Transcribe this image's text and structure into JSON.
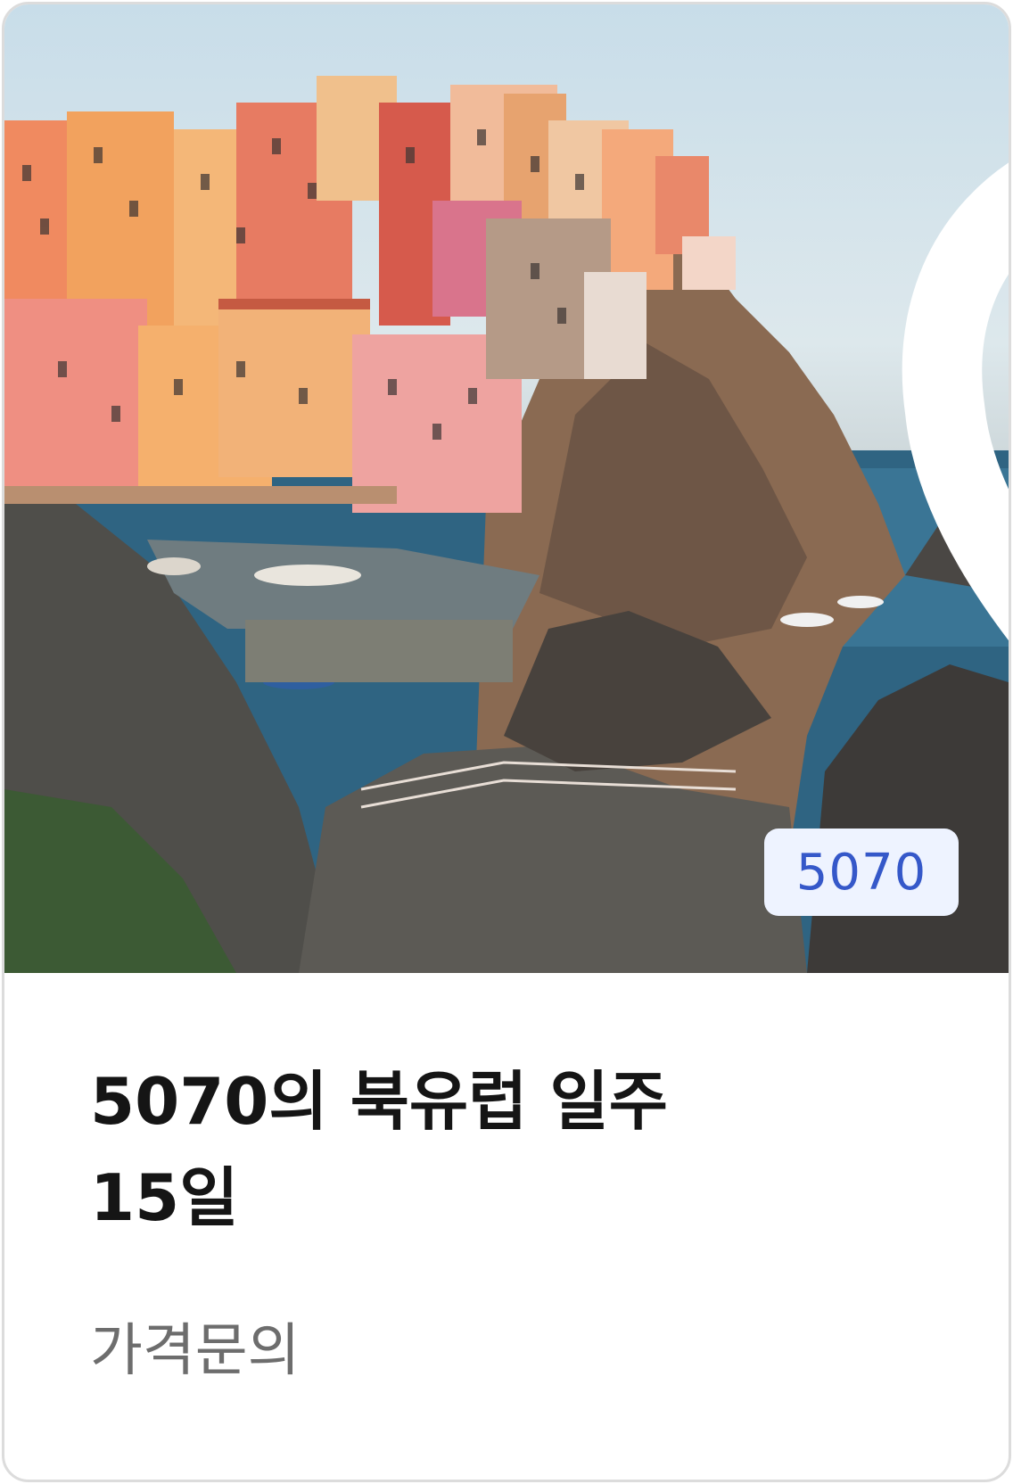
{
  "product": {
    "image_alt": "Cinque Terre colorful cliffside village by the sea",
    "favorite_icon": "heart-outline-icon",
    "badge": "5070",
    "title_line1": "5070의 북유럽 일주",
    "title_line2": "15일",
    "price": "가격문의"
  },
  "colors": {
    "badge_bg": "#eef3ff",
    "badge_text": "#3558c9",
    "title": "#151515",
    "price": "#6d6d6d",
    "border": "#dcdcdc"
  }
}
